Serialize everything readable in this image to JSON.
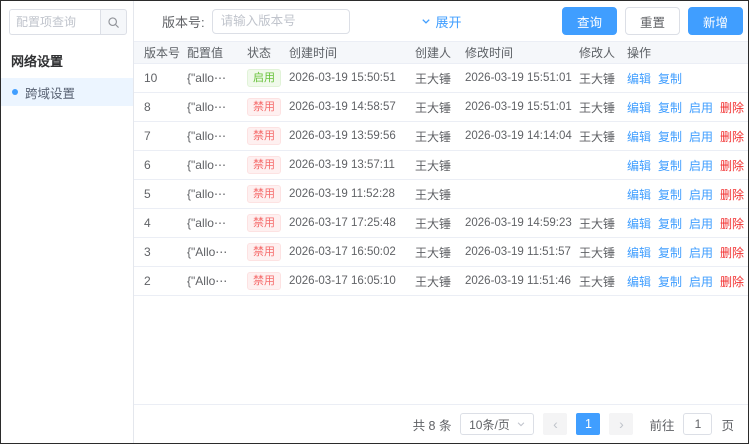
{
  "colors": {
    "accent": "#409eff",
    "danger": "#f56c6c",
    "success": "#67c23a"
  },
  "sidebar": {
    "search_placeholder": "配置项查询",
    "group_title": "网络设置",
    "active_item": "跨域设置"
  },
  "filter": {
    "version_label": "版本号:",
    "version_placeholder": "请输入版本号",
    "expand_label": "展开",
    "query_label": "查询",
    "reset_label": "重置",
    "add_label": "新增"
  },
  "table": {
    "columns": [
      "版本号",
      "配置值",
      "状态",
      "创建时间",
      "创建人",
      "修改时间",
      "修改人",
      "操作"
    ],
    "rows": [
      {
        "version": "10",
        "config": "{\"allo⋯",
        "status": {
          "label": "启用",
          "type": "success"
        },
        "created": "2026-03-19 15:50:51",
        "creator": "王大锤",
        "modified": "2026-03-19 15:51:01",
        "modifier": "王大锤",
        "actions": [
          {
            "label": "编辑",
            "type": "edit"
          },
          {
            "label": "复制",
            "type": "copy"
          }
        ]
      },
      {
        "version": "8",
        "config": "{\"allo⋯",
        "status": {
          "label": "禁用",
          "type": "danger"
        },
        "created": "2026-03-19 14:58:57",
        "creator": "王大锤",
        "modified": "2026-03-19 15:51:01",
        "modifier": "王大锤",
        "actions": [
          {
            "label": "编辑",
            "type": "edit"
          },
          {
            "label": "复制",
            "type": "copy"
          },
          {
            "label": "启用",
            "type": "enable"
          },
          {
            "label": "删除",
            "type": "delete"
          }
        ]
      },
      {
        "version": "7",
        "config": "{\"allo⋯",
        "status": {
          "label": "禁用",
          "type": "danger"
        },
        "created": "2026-03-19 13:59:56",
        "creator": "王大锤",
        "modified": "2026-03-19 14:14:04",
        "modifier": "王大锤",
        "actions": [
          {
            "label": "编辑",
            "type": "edit"
          },
          {
            "label": "复制",
            "type": "copy"
          },
          {
            "label": "启用",
            "type": "enable"
          },
          {
            "label": "删除",
            "type": "delete"
          }
        ]
      },
      {
        "version": "6",
        "config": "{\"allo⋯",
        "status": {
          "label": "禁用",
          "type": "danger"
        },
        "created": "2026-03-19 13:57:11",
        "creator": "王大锤",
        "modified": "",
        "modifier": "",
        "actions": [
          {
            "label": "编辑",
            "type": "edit"
          },
          {
            "label": "复制",
            "type": "copy"
          },
          {
            "label": "启用",
            "type": "enable"
          },
          {
            "label": "删除",
            "type": "delete"
          }
        ]
      },
      {
        "version": "5",
        "config": "{\"allo⋯",
        "status": {
          "label": "禁用",
          "type": "danger"
        },
        "created": "2026-03-19 11:52:28",
        "creator": "王大锤",
        "modified": "",
        "modifier": "",
        "actions": [
          {
            "label": "编辑",
            "type": "edit"
          },
          {
            "label": "复制",
            "type": "copy"
          },
          {
            "label": "启用",
            "type": "enable"
          },
          {
            "label": "删除",
            "type": "delete"
          }
        ]
      },
      {
        "version": "4",
        "config": "{\"allo⋯",
        "status": {
          "label": "禁用",
          "type": "danger"
        },
        "created": "2026-03-17 17:25:48",
        "creator": "王大锤",
        "modified": "2026-03-19 14:59:23",
        "modifier": "王大锤",
        "actions": [
          {
            "label": "编辑",
            "type": "edit"
          },
          {
            "label": "复制",
            "type": "copy"
          },
          {
            "label": "启用",
            "type": "enable"
          },
          {
            "label": "删除",
            "type": "delete"
          }
        ]
      },
      {
        "version": "3",
        "config": "{\"Allo⋯",
        "status": {
          "label": "禁用",
          "type": "danger"
        },
        "created": "2026-03-17 16:50:02",
        "creator": "王大锤",
        "modified": "2026-03-19 11:51:57",
        "modifier": "王大锤",
        "actions": [
          {
            "label": "编辑",
            "type": "edit"
          },
          {
            "label": "复制",
            "type": "copy"
          },
          {
            "label": "启用",
            "type": "enable"
          },
          {
            "label": "删除",
            "type": "delete"
          }
        ]
      },
      {
        "version": "2",
        "config": "{\"Allo⋯",
        "status": {
          "label": "禁用",
          "type": "danger"
        },
        "created": "2026-03-17 16:05:10",
        "creator": "王大锤",
        "modified": "2026-03-19 11:51:46",
        "modifier": "王大锤",
        "actions": [
          {
            "label": "编辑",
            "type": "edit"
          },
          {
            "label": "复制",
            "type": "copy"
          },
          {
            "label": "启用",
            "type": "enable"
          },
          {
            "label": "删除",
            "type": "delete"
          }
        ]
      }
    ]
  },
  "pagination": {
    "total_label": "共 8 条",
    "page_size_value": "10条/页",
    "prev_icon": "‹",
    "current_page": "1",
    "next_icon": "›",
    "goto_label": "前往",
    "goto_value": "1",
    "page_suffix": "页"
  }
}
